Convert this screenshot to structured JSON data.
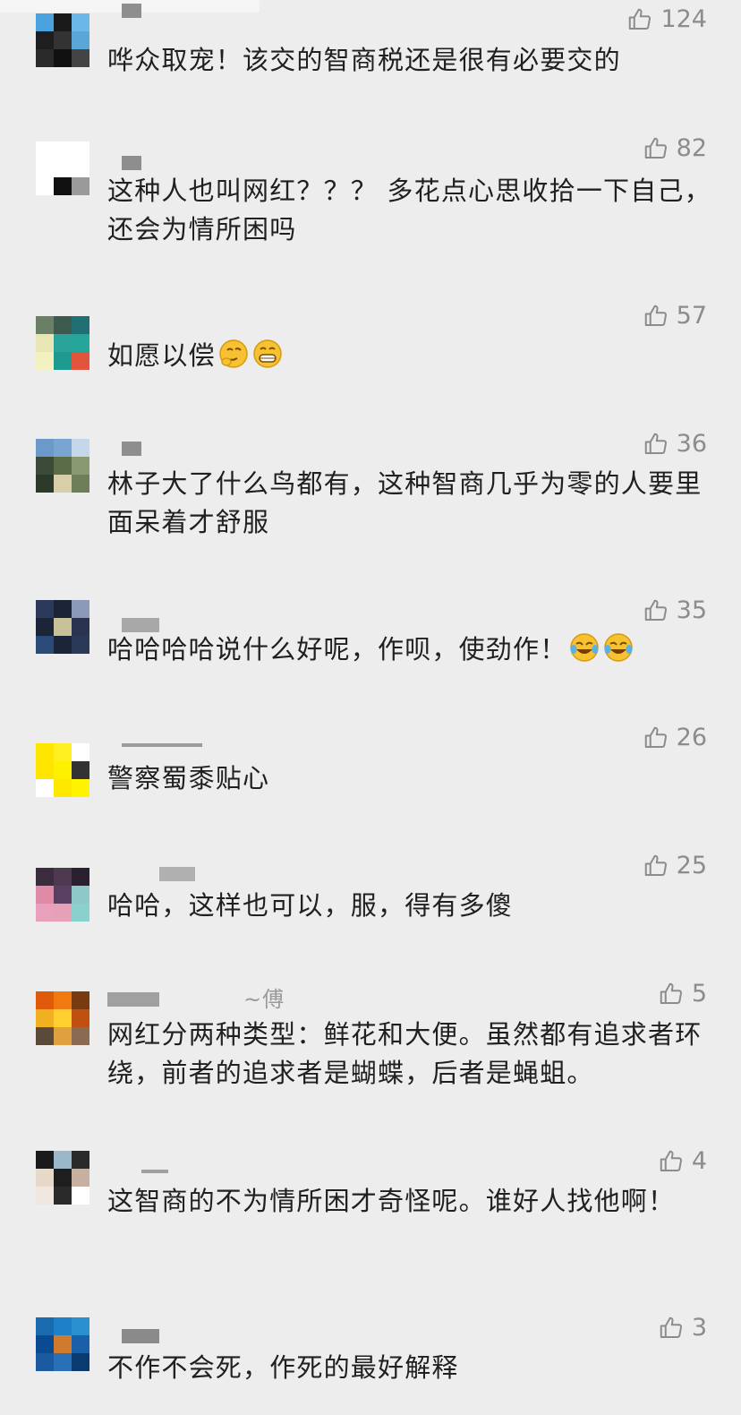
{
  "comments": [
    {
      "username": "",
      "likes": "124",
      "text": "哗众取宠！该交的智商税还是很有必要交的",
      "avatar_colors": [
        "#4aa3df",
        "#1a1a1a",
        "#6bb7e8",
        "#1e1e1e",
        "#333333",
        "#5aa6d6",
        "#2a2a2a",
        "#111111",
        "#444444"
      ]
    },
    {
      "username": "",
      "likes": "82",
      "text": "这种人也叫网红？？？ 多花点心思收拾一下自己，还会为情所困吗",
      "avatar_colors": [
        "#ffffff",
        "#ffffff",
        "#ffffff",
        "#ffffff",
        "#ffffff",
        "#ffffff",
        "#ffffff",
        "#111111",
        "#9a9a9a"
      ]
    },
    {
      "username": "",
      "likes": "57",
      "text": "如愿以偿",
      "avatar_colors": [
        "#6a7f63",
        "#3c5a4d",
        "#1f6f74",
        "#e9e6b5",
        "#2aa39b",
        "#26a69a",
        "#f4f1c0",
        "#1e9a90",
        "#e2553c"
      ]
    },
    {
      "username": "",
      "likes": "36",
      "text": "林子大了什么鸟都有，这种智商几乎为零的人要里面呆着才舒服",
      "avatar_colors": [
        "#6b9ac9",
        "#7aa5d0",
        "#c5d7ea",
        "#3c4a3a",
        "#5a6d48",
        "#8a9a70",
        "#2d3a2a",
        "#d8ceaa",
        "#6e7e58"
      ]
    },
    {
      "username": "",
      "likes": "35",
      "text": "哈哈哈哈说什么好呢，作呗，使劲作！",
      "avatar_colors": [
        "#2b3a5a",
        "#1b2436",
        "#8a9ab8",
        "#1c2438",
        "#c8c098",
        "#2a3450",
        "#2a4a7a",
        "#1c2438",
        "#2c3858"
      ]
    },
    {
      "username": "",
      "likes": "26",
      "text": "警察蜀黍贴心",
      "avatar_colors": [
        "#ffe600",
        "#ffee20",
        "#ffffff",
        "#ffe400",
        "#fff000",
        "#333333",
        "#ffffff",
        "#ffe800",
        "#fff400"
      ]
    },
    {
      "username": "",
      "likes": "25",
      "text": "哈哈，这样也可以，服，得有多傻",
      "avatar_colors": [
        "#3a2c3e",
        "#4d3a50",
        "#2a2030",
        "#e08aa8",
        "#5a4060",
        "#8fc8c8",
        "#e8a0bc",
        "#e6a0b8",
        "#8ad0cc"
      ]
    },
    {
      "username": "傅",
      "likes": "5",
      "text": "网红分两种类型：鲜花和大便。虽然都有追求者环绕，前者的追求者是蝴蝶，后者是蝇蛆。",
      "avatar_colors": [
        "#e05a0c",
        "#f07a10",
        "#7a3a10",
        "#f0b020",
        "#ffd030",
        "#c05010",
        "#5a4a3a",
        "#e0a040",
        "#8a6a50"
      ]
    },
    {
      "username": "",
      "likes": "4",
      "text": "这智商的不为情所困才奇怪呢。谁好人找他啊！",
      "avatar_colors": [
        "#1a1a1a",
        "#9ab8c8",
        "#2a2a2a",
        "#e8d8c8",
        "#1e1e1e",
        "#c8b0a0",
        "#f0e8e0",
        "#2a2a2a",
        "#ffffff"
      ]
    },
    {
      "username": "",
      "likes": "3",
      "text": "不作不会死，作死的最好解释",
      "avatar_colors": [
        "#1a6ab0",
        "#1e80c8",
        "#2a90d0",
        "#0a4a90",
        "#d07a30",
        "#1a60a8",
        "#1a5aa0",
        "#2a70b8",
        "#0a3a70"
      ]
    }
  ],
  "emoji_names": [
    "thinking-emoji",
    "grin-emoji",
    "tears-of-joy-emoji"
  ]
}
